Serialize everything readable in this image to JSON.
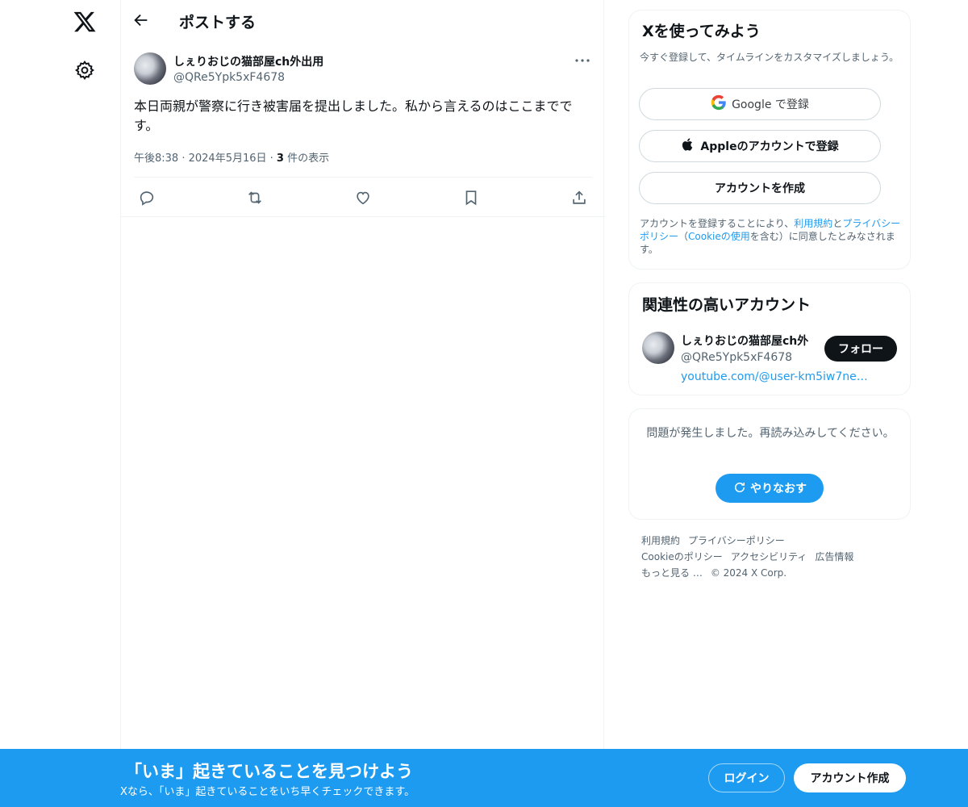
{
  "header": {
    "title": "ポストする"
  },
  "post": {
    "author_name": "しぇりおじの猫部屋ch外出用",
    "author_handle": "@QRe5Ypk5xF4678",
    "text": "本日両親が警察に行き被害届を提出しました。私から言えるのはここまでです。",
    "time": "午後8:38",
    "date": "2024年5月16日",
    "views_count": "3",
    "views_label": "件の表示"
  },
  "signup_card": {
    "title": "Xを使ってみよう",
    "subtitle": "今すぐ登録して、タイムラインをカスタマイズしましょう。",
    "google_label": "Google で登録",
    "apple_label": "Appleのアカウントで登録",
    "create_label": "アカウントを作成",
    "terms_prefix": "アカウントを登録することにより、",
    "terms_link": "利用規約",
    "terms_and": "と",
    "privacy_link": "プライバシーポリシー",
    "terms_paren_open": "（",
    "cookie_link": "Cookieの使用",
    "terms_paren_close": "を含む）に同意したとみなされます。"
  },
  "related_card": {
    "title": "関連性の高いアカウント",
    "name": "しぇりおじの猫部屋ch外",
    "handle": "@QRe5Ypk5xF4678",
    "link": "youtube.com/@user-km5iw7ne…",
    "follow_label": "フォロー"
  },
  "error_card": {
    "message": "問題が発生しました。再読み込みしてください。",
    "retry_label": "やりなおす"
  },
  "footer": {
    "links": [
      "利用規約",
      "プライバシーポリシー",
      "Cookieのポリシー",
      "アクセシビリティ",
      "広告情報",
      "もっと見る …"
    ],
    "copyright": "© 2024 X Corp."
  },
  "bottom_bar": {
    "title": "「いま」起きていることを見つけよう",
    "subtitle": "Xなら、「いま」起きていることをいち早くチェックできます。",
    "login_label": "ログイン",
    "signup_label": "アカウント作成"
  },
  "colors": {
    "accent": "#1d9bf0",
    "text": "#0f1419",
    "muted": "#536471"
  },
  "icons": [
    "x-logo-icon",
    "settings-icon",
    "back-arrow-icon",
    "more-icon",
    "reply-icon",
    "repost-icon",
    "like-icon",
    "bookmark-icon",
    "share-icon",
    "google-icon",
    "apple-icon",
    "refresh-icon"
  ]
}
